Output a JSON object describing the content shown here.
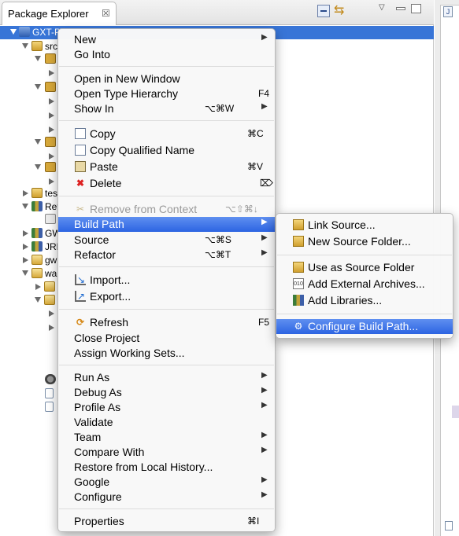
{
  "view": {
    "title": "Package Explorer",
    "close_glyph": "☒",
    "toolbar": {
      "collapse_icon": "collapse-all-icon",
      "link_icon": "link-with-editor-icon",
      "link_glyph": "⇆",
      "view_menu_glyph": "▽",
      "menu_icon": "view-menu-icon"
    }
  },
  "tree": [
    {
      "label": "GXT-P",
      "icon": "project-icon",
      "selected": true
    },
    {
      "label": "src",
      "icon": "source-folder-icon"
    },
    {
      "label": "",
      "icon": "package-icon"
    },
    {
      "label": "",
      "icon": "package-icon"
    },
    {
      "label": "tes",
      "icon": "source-folder-icon"
    },
    {
      "label": "Ref",
      "icon": "library-icon"
    },
    {
      "label": "GW",
      "icon": "library-icon"
    },
    {
      "label": "JRE",
      "icon": "library-icon"
    },
    {
      "label": "gw",
      "icon": "folder-icon"
    },
    {
      "label": "war",
      "icon": "folder-icon"
    }
  ],
  "context_menu": {
    "items": [
      {
        "label": "New",
        "submenu": true
      },
      {
        "label": "Go Into"
      },
      {
        "label": "Open in New Window"
      },
      {
        "label": "Open Type Hierarchy",
        "shortcut": "F4"
      },
      {
        "label": "Show In",
        "shortcut": "⌥⌘W",
        "submenu": true
      },
      {
        "label": "Copy",
        "shortcut": "⌘C",
        "icon": "copy-icon"
      },
      {
        "label": "Copy Qualified Name",
        "icon": "copy-qualified-name-icon"
      },
      {
        "label": "Paste",
        "shortcut": "⌘V",
        "icon": "paste-icon"
      },
      {
        "label": "Delete",
        "shortcut": "⌦",
        "icon": "delete-icon",
        "icon_glyph": "✖"
      },
      {
        "label": "Remove from Context",
        "shortcut": "⌥⇧⌘↓",
        "icon": "remove-context-icon",
        "disabled": true
      },
      {
        "label": "Build Path",
        "submenu": true,
        "highlighted": true
      },
      {
        "label": "Source",
        "shortcut": "⌥⌘S",
        "submenu": true
      },
      {
        "label": "Refactor",
        "shortcut": "⌥⌘T",
        "submenu": true
      },
      {
        "label": "Import...",
        "icon": "import-icon"
      },
      {
        "label": "Export...",
        "icon": "export-icon"
      },
      {
        "label": "Refresh",
        "shortcut": "F5",
        "icon": "refresh-icon",
        "icon_glyph": "⟳"
      },
      {
        "label": "Close Project"
      },
      {
        "label": "Assign Working Sets..."
      },
      {
        "label": "Run As",
        "submenu": true
      },
      {
        "label": "Debug As",
        "submenu": true
      },
      {
        "label": "Profile As",
        "submenu": true
      },
      {
        "label": "Validate"
      },
      {
        "label": "Team",
        "submenu": true
      },
      {
        "label": "Compare With",
        "submenu": true
      },
      {
        "label": "Restore from Local History..."
      },
      {
        "label": "Google",
        "submenu": true
      },
      {
        "label": "Configure",
        "submenu": true
      },
      {
        "label": "Properties",
        "shortcut": "⌘I"
      }
    ],
    "submenu_arrow": "▶"
  },
  "build_path_menu": {
    "items": [
      {
        "label": "Link Source...",
        "icon": "link-source-icon"
      },
      {
        "label": "New Source Folder...",
        "icon": "new-source-folder-icon"
      },
      {
        "label": "Use as Source Folder",
        "icon": "use-as-source-folder-icon"
      },
      {
        "label": "Add External Archives...",
        "icon": "add-external-archives-icon",
        "icon_glyph": "010"
      },
      {
        "label": "Add Libraries...",
        "icon": "add-libraries-icon"
      },
      {
        "label": "Configure Build Path...",
        "icon": "configure-build-path-icon",
        "icon_glyph": "⚙",
        "highlighted": true
      }
    ]
  },
  "colors": {
    "selection": "#3875d7",
    "menu_highlight": "#2c64e2"
  }
}
